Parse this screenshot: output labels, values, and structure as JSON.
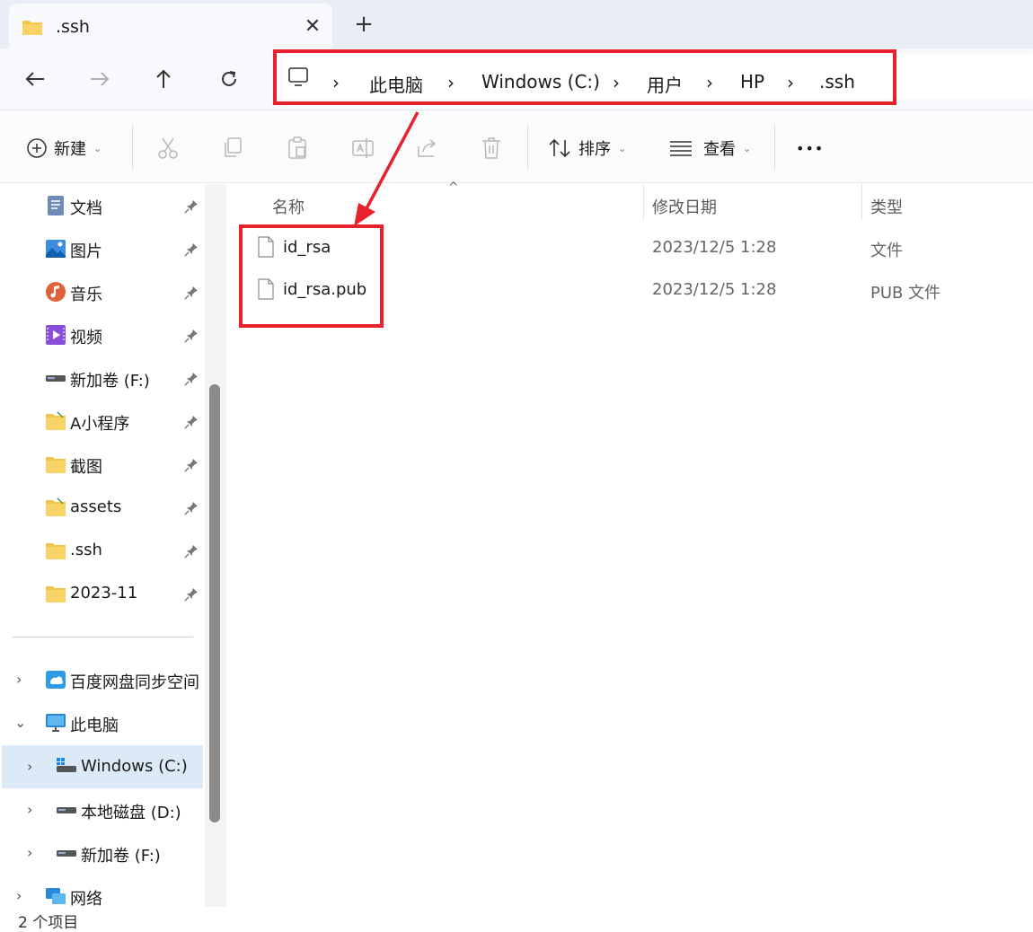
{
  "tab": {
    "title": ".ssh",
    "close_icon": "close-icon",
    "new_tab_icon": "plus-icon"
  },
  "nav_buttons": {
    "back": "back-arrow-icon",
    "forward": "forward-arrow-icon",
    "up": "up-arrow-icon",
    "refresh": "refresh-icon"
  },
  "breadcrumb": {
    "root_icon": "computer-icon",
    "items": [
      "此电脑",
      "Windows (C:)",
      "用户",
      "HP",
      ".ssh"
    ]
  },
  "toolbar": {
    "new_label": "新建",
    "sort_label": "排序",
    "view_label": "查看",
    "more_label": "•••",
    "icons": [
      "cut-icon",
      "copy-icon",
      "paste-icon",
      "rename-icon",
      "share-icon",
      "delete-icon"
    ]
  },
  "sidebar": {
    "quick_access": [
      {
        "label": "文档",
        "icon": "documents-icon"
      },
      {
        "label": "图片",
        "icon": "pictures-icon"
      },
      {
        "label": "音乐",
        "icon": "music-icon"
      },
      {
        "label": "视频",
        "icon": "videos-icon"
      },
      {
        "label": "新加卷 (F:)",
        "icon": "drive-icon"
      },
      {
        "label": "A小程序",
        "icon": "folder-icon"
      },
      {
        "label": "截图",
        "icon": "folder-icon"
      },
      {
        "label": "assets",
        "icon": "folder-icon"
      },
      {
        "label": ".ssh",
        "icon": "folder-icon"
      },
      {
        "label": "2023-11",
        "icon": "folder-icon"
      }
    ],
    "tree": [
      {
        "label": "百度网盘同步空间",
        "icon": "cloud-sync-icon"
      },
      {
        "label": "此电脑",
        "icon": "computer-icon"
      },
      {
        "label": "Windows (C:)",
        "icon": "windows-drive-icon"
      },
      {
        "label": "本地磁盘 (D:)",
        "icon": "drive-icon"
      },
      {
        "label": "新加卷 (F:)",
        "icon": "drive-icon"
      },
      {
        "label": "网络",
        "icon": "network-icon"
      }
    ]
  },
  "file_list": {
    "columns": [
      "名称",
      "修改日期",
      "类型"
    ],
    "files": [
      {
        "name": "id_rsa",
        "date": "2023/12/5 1:28",
        "type": "文件"
      },
      {
        "name": "id_rsa.pub",
        "date": "2023/12/5 1:28",
        "type": "PUB 文件"
      }
    ]
  },
  "status": {
    "text": "2 个项目"
  },
  "colors": {
    "highlight": "#e8222c",
    "selection": "#dce9f6",
    "folder": "#f4c64a"
  }
}
